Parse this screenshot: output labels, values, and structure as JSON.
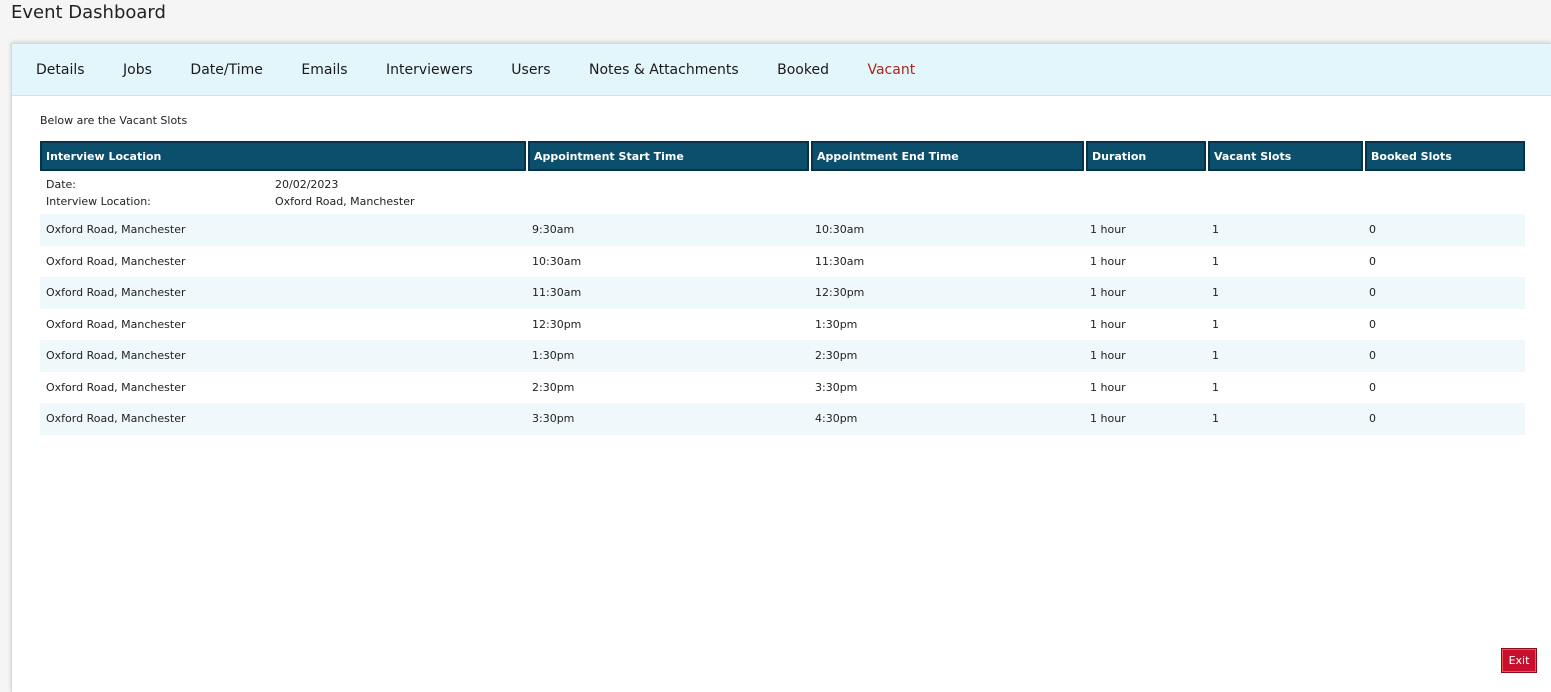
{
  "page": {
    "title": "Event Dashboard"
  },
  "tabs": [
    {
      "label": "Details",
      "active": false
    },
    {
      "label": "Jobs",
      "active": false
    },
    {
      "label": "Date/Time",
      "active": false
    },
    {
      "label": "Emails",
      "active": false
    },
    {
      "label": "Interviewers",
      "active": false
    },
    {
      "label": "Users",
      "active": false
    },
    {
      "label": "Notes & Attachments",
      "active": false
    },
    {
      "label": "Booked",
      "active": false
    },
    {
      "label": "Vacant",
      "active": true
    }
  ],
  "main": {
    "intro": "Below are the Vacant Slots",
    "table": {
      "headers": [
        "Interview Location",
        "Appointment Start Time",
        "Appointment End Time",
        "Duration",
        "Vacant Slots",
        "Booked Slots"
      ],
      "info": {
        "date_label": "Date:",
        "date_value": "20/02/2023",
        "location_label": "Interview Location:",
        "location_value": "Oxford Road, Manchester"
      },
      "rows": [
        [
          "Oxford Road, Manchester",
          "9:30am",
          "10:30am",
          "1 hour",
          "1",
          "0"
        ],
        [
          "Oxford Road, Manchester",
          "10:30am",
          "11:30am",
          "1 hour",
          "1",
          "0"
        ],
        [
          "Oxford Road, Manchester",
          "11:30am",
          "12:30pm",
          "1 hour",
          "1",
          "0"
        ],
        [
          "Oxford Road, Manchester",
          "12:30pm",
          "1:30pm",
          "1 hour",
          "1",
          "0"
        ],
        [
          "Oxford Road, Manchester",
          "1:30pm",
          "2:30pm",
          "1 hour",
          "1",
          "0"
        ],
        [
          "Oxford Road, Manchester",
          "2:30pm",
          "3:30pm",
          "1 hour",
          "1",
          "0"
        ],
        [
          "Oxford Road, Manchester",
          "3:30pm",
          "4:30pm",
          "1 hour",
          "1",
          "0"
        ]
      ]
    }
  },
  "actions": {
    "exit_label": "Exit"
  },
  "colors": {
    "header_bg": "#0c4f6c",
    "tabbar_bg": "#e3f6fb",
    "active_tab": "#a8261a",
    "zebra_row": "#eff9fc",
    "exit_button": "#c8102e"
  }
}
